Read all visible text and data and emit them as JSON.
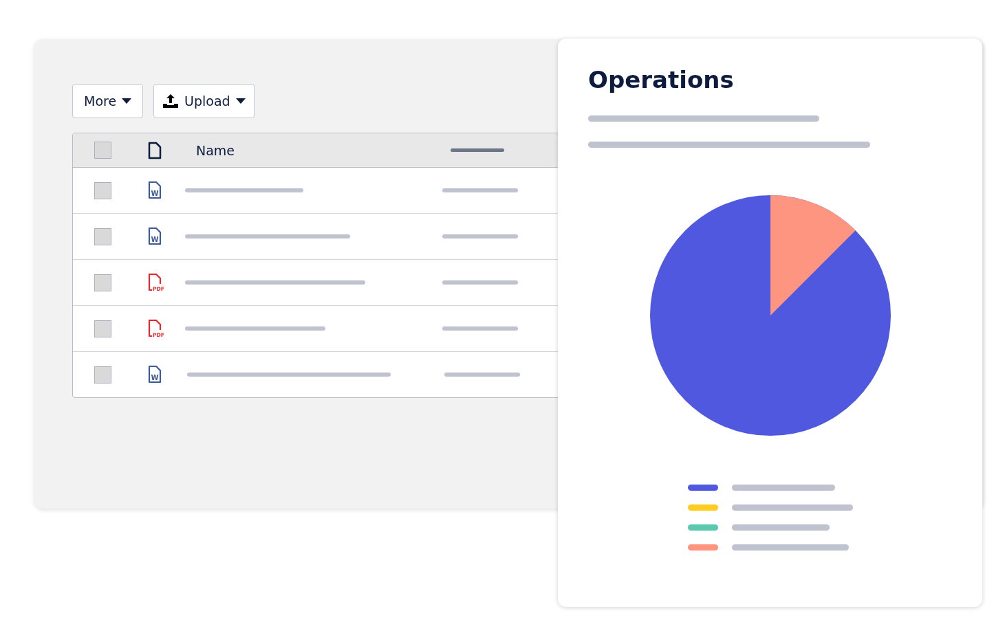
{
  "toolbar": {
    "buttons": [
      {
        "label": "More",
        "kind": "menu"
      },
      {
        "label": "Upload",
        "kind": "upload"
      }
    ]
  },
  "table": {
    "header": {
      "checked": false,
      "name": "Name"
    },
    "rows": [
      {
        "kind": "word",
        "icon_text": "W",
        "checked": false
      },
      {
        "kind": "word",
        "icon_text": "W",
        "checked": false
      },
      {
        "kind": "pdf",
        "icon_text": "PDF",
        "checked": false
      },
      {
        "kind": "pdf",
        "icon_text": "PDF",
        "checked": false
      },
      {
        "kind": "word",
        "icon_text": "W",
        "checked": false
      }
    ]
  },
  "panel": {
    "title": "Operations",
    "legend": [
      {
        "color": "#5058e0"
      },
      {
        "color": "#ffcc22"
      },
      {
        "color": "#5bc8b0"
      },
      {
        "color": "#fe9580"
      }
    ]
  }
}
